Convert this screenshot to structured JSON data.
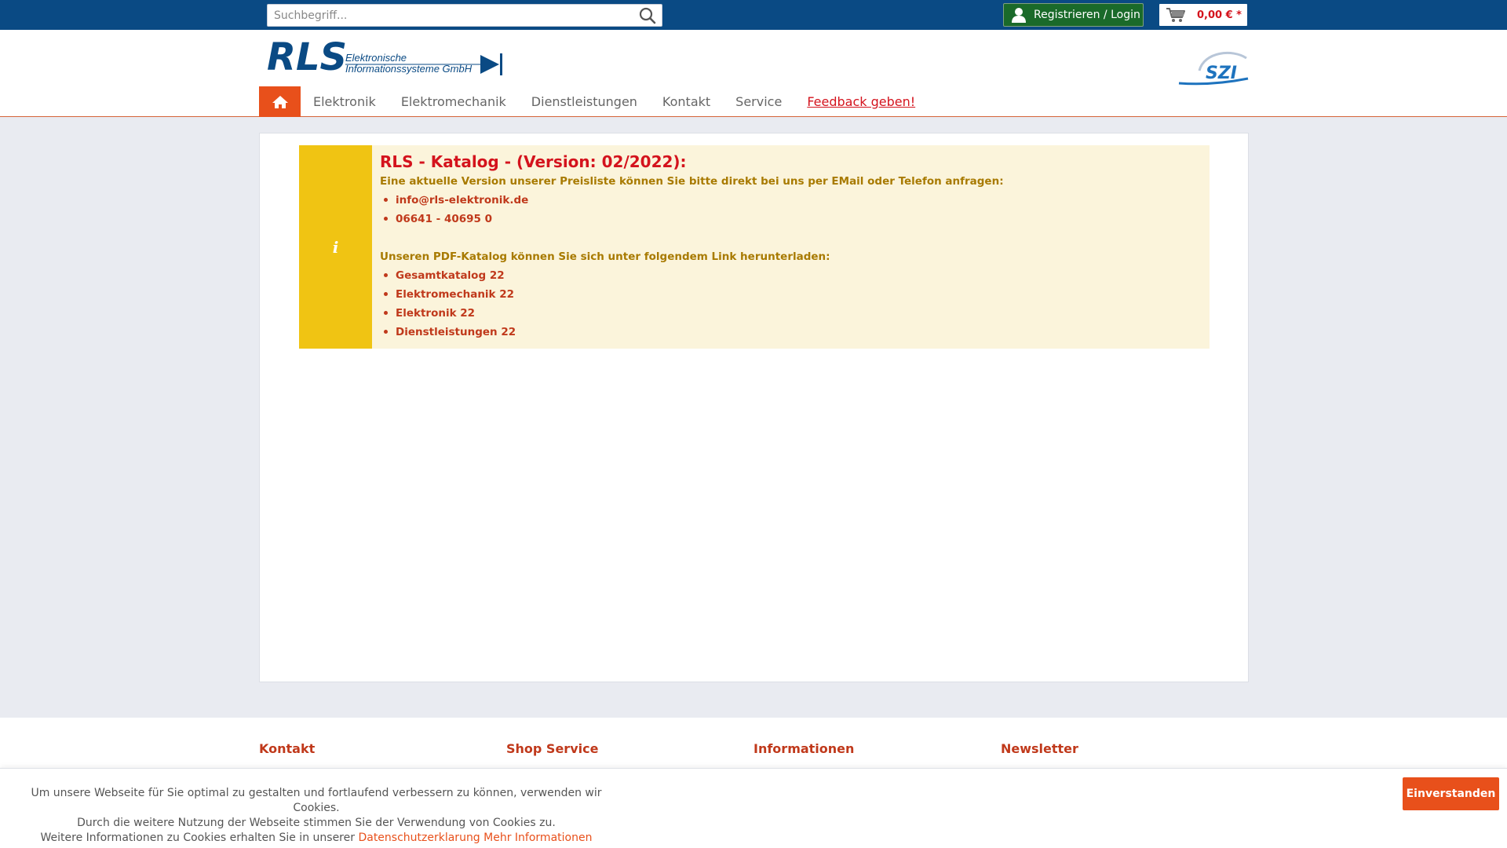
{
  "topbar": {
    "search_placeholder": "Suchbegriff...",
    "search_icon": "search-icon",
    "login_label": "Registrieren / Login",
    "cart_amount": "0,00 € *"
  },
  "header": {
    "logo_text": "RLS",
    "logo_subtitle_1": "Elektronische",
    "logo_subtitle_2": "Informationssysteme GmbH",
    "partner_logo_text": "SZI"
  },
  "nav": {
    "items": [
      {
        "label": "Elektronik"
      },
      {
        "label": "Elektromechanik"
      },
      {
        "label": "Dienstleistungen"
      },
      {
        "label": "Kontakt"
      },
      {
        "label": "Service"
      },
      {
        "label": "Feedback geben!"
      }
    ]
  },
  "alert": {
    "icon": "info-icon",
    "title": "RLS - Katalog - (Version: 02/2022):",
    "intro": "Eine aktuelle Version unserer Preisliste können Sie bitte direkt bei uns per EMail oder Telefon anfragen:",
    "contacts": [
      "info@rls-elektronik.de",
      "06641 - 40695 0"
    ],
    "download_intro": "Unseren PDF-Katalog können Sie sich unter folgendem Link herunterladen:",
    "downloads": [
      "Gesamtkatalog 22",
      "Elektromechanik 22",
      "Elektronik 22",
      "Dienstleistungen 22"
    ]
  },
  "footer": {
    "columns": [
      "Kontakt",
      "Shop Service",
      "Informationen",
      "Newsletter"
    ]
  },
  "cookie": {
    "line1": "Um unsere Webseite für Sie optimal zu gestalten und fortlaufend verbessern zu können, verwenden wir Cookies.",
    "line2": "Durch die weitere Nutzung der Webseite stimmen Sie der Verwendung von Cookies zu.",
    "line3": "Weitere Informationen zu Cookies erhalten Sie in unserer",
    "privacy_link": "Datenschutzerklarung",
    "more_link": "Mehr Informationen",
    "accept_label": "Einverstanden"
  },
  "colors": {
    "topbar": "#0a4a84",
    "accent": "#e8501b",
    "alert_bg": "#fbf4db",
    "alert_side": "#f0c413",
    "login_green": "#1a6a2a"
  }
}
